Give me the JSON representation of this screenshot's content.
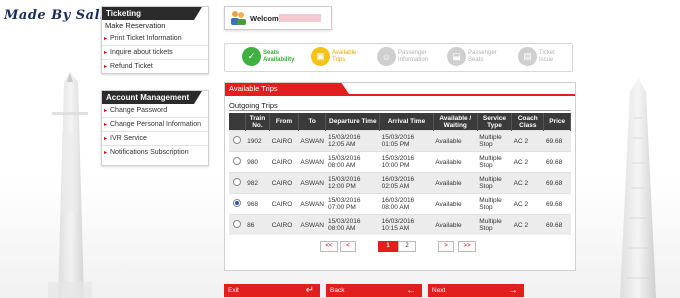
{
  "watermark": "Made By Sally",
  "sidebar": {
    "ticketing": {
      "title": "Ticketing",
      "subtitle": "Make Reservation",
      "items": [
        {
          "label": "Print Ticket Information"
        },
        {
          "label": "Inquire about tickets"
        },
        {
          "label": "Refund Ticket"
        }
      ]
    },
    "account": {
      "title": "Account Management",
      "items": [
        {
          "label": "Change Password"
        },
        {
          "label": "Change Personal Information"
        },
        {
          "label": "IVR Service"
        },
        {
          "label": "Notifications Subscription"
        }
      ]
    }
  },
  "welcome": {
    "label": "Welcome"
  },
  "steps": [
    {
      "label1": "Seats",
      "label2": "Availability",
      "icon": "check-icon",
      "color": "#3fb041",
      "text_color": "#3fa83a"
    },
    {
      "label1": "Available",
      "label2": "Trips",
      "icon": "train-icon",
      "color": "#f2c316",
      "text_color": "#e0a800"
    },
    {
      "label1": "Passenger",
      "label2": "Information",
      "icon": "person-icon",
      "color": "#cfcfcf",
      "text_color": "#b0b0b0"
    },
    {
      "label1": "Passenger",
      "label2": "Seats",
      "icon": "seat-icon",
      "color": "#cfcfcf",
      "text_color": "#b0b0b0"
    },
    {
      "label1": "Ticket",
      "label2": "Issue",
      "icon": "ticket-icon",
      "color": "#cfcfcf",
      "text_color": "#b0b0b0"
    }
  ],
  "trips": {
    "tab_label": "Available Trips",
    "section_label": "Outgoing Trips",
    "columns": [
      "",
      "Train No.",
      "From",
      "To",
      "Departure Time",
      "Arrival Time",
      "Available / Waiting",
      "Service Type",
      "Coach Class",
      "Price"
    ],
    "rows": [
      {
        "selected": false,
        "train": "1902",
        "from": "CAIRO",
        "to": "ASWAN",
        "dep_date": "15/03/2016",
        "dep_time": "12:05 AM",
        "arr_date": "15/03/2016",
        "arr_time": "01:05 PM",
        "avail": "Available",
        "service1": "Multiple",
        "service2": "Stop",
        "class": "AC 2",
        "price": "69.68"
      },
      {
        "selected": false,
        "train": "980",
        "from": "CAIRO",
        "to": "ASWAN",
        "dep_date": "15/03/2016",
        "dep_time": "08:00 AM",
        "arr_date": "15/03/2016",
        "arr_time": "10:00 PM",
        "avail": "Available",
        "service1": "Multiple",
        "service2": "Stop",
        "class": "AC 2",
        "price": "69.68"
      },
      {
        "selected": false,
        "train": "982",
        "from": "CAIRO",
        "to": "ASWAN",
        "dep_date": "15/03/2016",
        "dep_time": "12:00 PM",
        "arr_date": "16/03/2016",
        "arr_time": "02:05 AM",
        "avail": "Available",
        "service1": "Multiple",
        "service2": "Stop",
        "class": "AC 2",
        "price": "69.68"
      },
      {
        "selected": true,
        "train": "968",
        "from": "CAIRO",
        "to": "ASWAN",
        "dep_date": "15/03/2016",
        "dep_time": "07:00 PM",
        "arr_date": "16/03/2016",
        "arr_time": "08:00 AM",
        "avail": "Available",
        "service1": "Multiple",
        "service2": "Stop",
        "class": "AC 2",
        "price": "69.68"
      },
      {
        "selected": false,
        "train": "86",
        "from": "CAIRO",
        "to": "ASWAN",
        "dep_date": "15/03/2016",
        "dep_time": "08:00 AM",
        "arr_date": "16/03/2016",
        "arr_time": "10:15 AM",
        "avail": "Available",
        "service1": "Multiple",
        "service2": "Stop",
        "class": "AC 2",
        "price": "69.68"
      }
    ],
    "pager": {
      "first": "<<",
      "prev": "<",
      "pages": [
        "1",
        "2"
      ],
      "next": ">",
      "last": ">>"
    }
  },
  "buttons": {
    "exit": "Exit",
    "back": "Back",
    "next": "Next"
  },
  "colors": {
    "accent": "#e21e1e",
    "header_dark": "#2b2b2b"
  }
}
